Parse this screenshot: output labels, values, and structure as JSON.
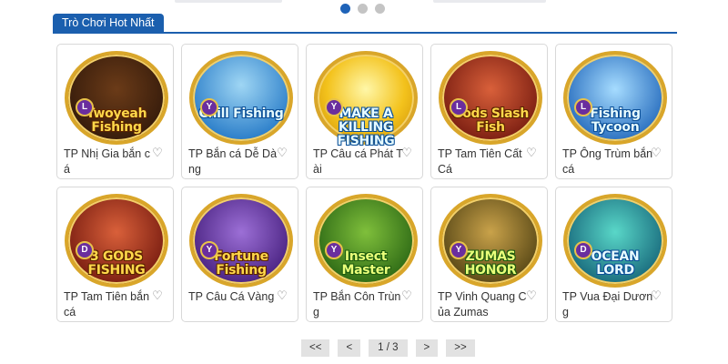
{
  "carousel": {
    "dots": 3,
    "active_dot": 1
  },
  "section": {
    "tab_label": "Trò Chơi Hot Nhất"
  },
  "games": [
    {
      "title": "TP Nhị Gia bắn cá",
      "logo": "Twoyeah Fishing",
      "badge": "L",
      "theme": ""
    },
    {
      "title": "TP Bắn cá Dễ Dàng",
      "logo": "Chill Fishing",
      "badge": "Y",
      "theme": "blue"
    },
    {
      "title": "TP Câu cá Phát Tài",
      "logo": "MAKE A KILLING FISHING",
      "badge": "Y",
      "theme": "sun"
    },
    {
      "title": "TP Tam Tiên Cất Cá",
      "logo": "Gods Slash Fish",
      "badge": "L",
      "theme": "red"
    },
    {
      "title": "TP Ông Trùm bắn cá",
      "logo": "Fishing Tycoon",
      "badge": "L",
      "theme": "ocean"
    },
    {
      "title": "TP Tam Tiên bắn cá",
      "logo": "3 GODS FISHING",
      "badge": "D",
      "theme": "red"
    },
    {
      "title": "TP Câu Cá Vàng",
      "logo": "Fortune Fishing",
      "badge": "Y",
      "theme": "purple"
    },
    {
      "title": "TP Bắn Côn Trùng",
      "logo": "Insect Master",
      "badge": "Y",
      "theme": "green"
    },
    {
      "title": "TP Vinh Quang Của Zumas",
      "logo": "ZUMAS HONOR",
      "badge": "Y",
      "theme": "jungle"
    },
    {
      "title": "TP Vua Đại Dương",
      "logo": "OCEAN LORD",
      "badge": "D",
      "theme": "teal"
    }
  ],
  "pagination": {
    "first": "<<",
    "prev": "<",
    "page_info": "1 / 3",
    "next": ">",
    "last": ">>"
  }
}
